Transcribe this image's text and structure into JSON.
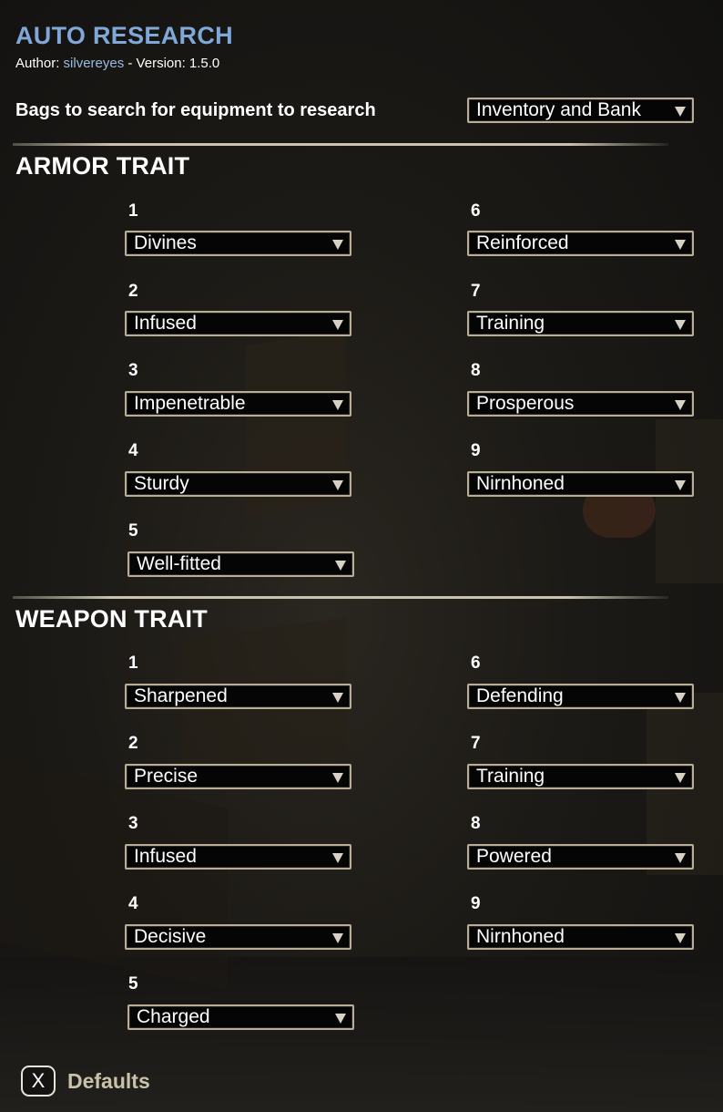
{
  "header": {
    "title": "AUTO RESEARCH",
    "author_prefix": "Author: ",
    "author_name": "silvereyes",
    "version_text": " - Version: 1.5.0"
  },
  "bags": {
    "label": "Bags to search for equipment to research",
    "value": "Inventory and Bank"
  },
  "armor": {
    "title": "ARMOR TRAIT",
    "slots": [
      {
        "number": "1",
        "value": "Divines"
      },
      {
        "number": "2",
        "value": "Infused"
      },
      {
        "number": "3",
        "value": "Impenetrable"
      },
      {
        "number": "4",
        "value": "Sturdy"
      },
      {
        "number": "5",
        "value": "Well-fitted"
      },
      {
        "number": "6",
        "value": "Reinforced"
      },
      {
        "number": "7",
        "value": "Training"
      },
      {
        "number": "8",
        "value": "Prosperous"
      },
      {
        "number": "9",
        "value": "Nirnhoned"
      }
    ]
  },
  "weapon": {
    "title": "WEAPON TRAIT",
    "slots": [
      {
        "number": "1",
        "value": "Sharpened"
      },
      {
        "number": "2",
        "value": "Precise"
      },
      {
        "number": "3",
        "value": "Infused"
      },
      {
        "number": "4",
        "value": "Decisive"
      },
      {
        "number": "5",
        "value": "Charged"
      },
      {
        "number": "6",
        "value": "Defending"
      },
      {
        "number": "7",
        "value": "Training"
      },
      {
        "number": "8",
        "value": "Powered"
      },
      {
        "number": "9",
        "value": "Nirnhoned"
      }
    ]
  },
  "footer": {
    "key": "X",
    "defaults_label": "Defaults"
  },
  "icons": {
    "dropdown_arrow": "chevron-down-icon",
    "defaults_key": "x-key-icon"
  },
  "colors": {
    "title": "#7fa8d8",
    "author": "#9bbbe0",
    "defaults_label": "#c9c2ab",
    "dropdown_border": "#b8ae98"
  }
}
